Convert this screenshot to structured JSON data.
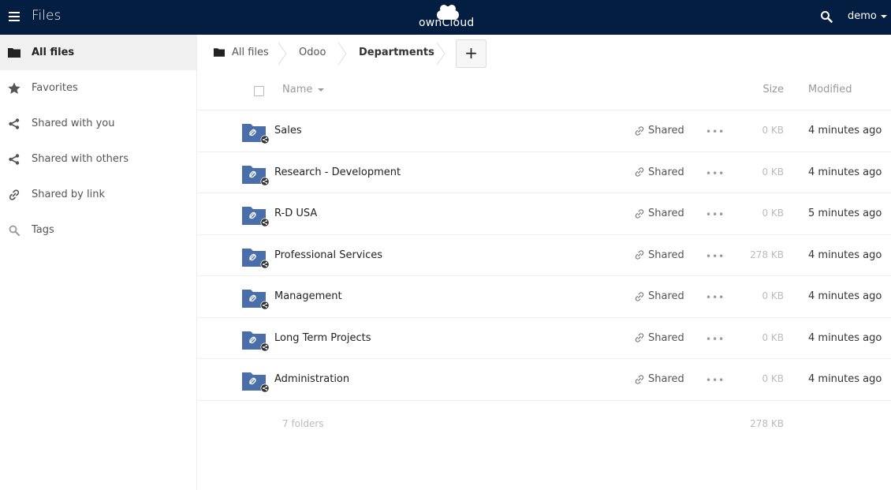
{
  "header": {
    "app_title": "Files",
    "logo_text": "ownCloud",
    "user": "demo"
  },
  "sidebar": {
    "items": [
      {
        "label": "All files",
        "icon": "folder-icon",
        "active": true
      },
      {
        "label": "Favorites",
        "icon": "star-icon"
      },
      {
        "label": "Shared with you",
        "icon": "share-icon"
      },
      {
        "label": "Shared with others",
        "icon": "share-icon"
      },
      {
        "label": "Shared by link",
        "icon": "link-icon"
      },
      {
        "label": "Tags",
        "icon": "search-icon"
      }
    ]
  },
  "breadcrumb": {
    "items": [
      "All files",
      "Odoo",
      "Departments"
    ],
    "add_label": "+"
  },
  "table": {
    "columns": {
      "name": "Name",
      "size": "Size",
      "modified": "Modified"
    },
    "rows": [
      {
        "name": "Sales",
        "share": "Shared",
        "more": "•••",
        "size": "0 KB",
        "modified": "4 minutes ago"
      },
      {
        "name": "Research - Development",
        "share": "Shared",
        "more": "•••",
        "size": "0 KB",
        "modified": "4 minutes ago"
      },
      {
        "name": "R-D USA",
        "share": "Shared",
        "more": "•••",
        "size": "0 KB",
        "modified": "5 minutes ago"
      },
      {
        "name": "Professional Services",
        "share": "Shared",
        "more": "•••",
        "size": "278 KB",
        "modified": "4 minutes ago"
      },
      {
        "name": "Management",
        "share": "Shared",
        "more": "•••",
        "size": "0 KB",
        "modified": "4 minutes ago"
      },
      {
        "name": "Long Term Projects",
        "share": "Shared",
        "more": "•••",
        "size": "0 KB",
        "modified": "4 minutes ago"
      },
      {
        "name": "Administration",
        "share": "Shared",
        "more": "•••",
        "size": "0 KB",
        "modified": "4 minutes ago"
      }
    ],
    "summary": {
      "count": "7 folders",
      "total": "278 KB"
    }
  },
  "colors": {
    "header_bg": "#041e42",
    "folder_blue": "#4a6ea9",
    "active_bg": "#f0f0f0"
  }
}
